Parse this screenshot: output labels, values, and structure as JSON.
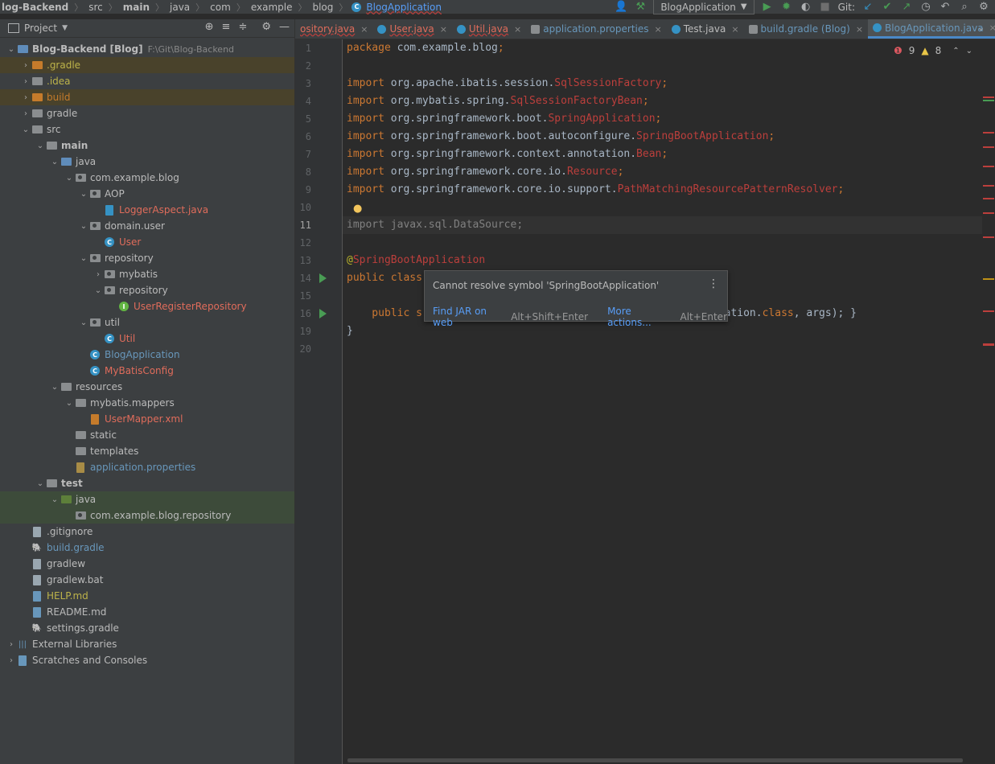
{
  "navbar": {
    "breadcrumbs": [
      "log-Backend",
      "src",
      "main",
      "java",
      "com",
      "example",
      "blog",
      "BlogApplication"
    ],
    "run_config": "BlogApplication",
    "git_label": "Git:"
  },
  "project_panel": {
    "title": "Project",
    "tree": [
      {
        "label": "Blog-Backend [Blog]",
        "path": "F:\\Git\\Blog-Backend",
        "depth": 0,
        "arrow": "down",
        "icon": "module-folder",
        "style": "bold"
      },
      {
        "label": ".gradle",
        "depth": 1,
        "arrow": "right",
        "icon": "folder-orange",
        "style": "yellow",
        "hl": "hl"
      },
      {
        "label": ".idea",
        "depth": 1,
        "arrow": "right",
        "icon": "folder",
        "style": "yellow"
      },
      {
        "label": "build",
        "depth": 1,
        "arrow": "right",
        "icon": "folder-orange",
        "style": "orange",
        "hl": "hl"
      },
      {
        "label": "gradle",
        "depth": 1,
        "arrow": "right",
        "icon": "folder",
        "style": ""
      },
      {
        "label": "src",
        "depth": 1,
        "arrow": "down",
        "icon": "folder",
        "style": ""
      },
      {
        "label": "main",
        "depth": 2,
        "arrow": "down",
        "icon": "folder",
        "style": "bold"
      },
      {
        "label": "java",
        "depth": 3,
        "arrow": "down",
        "icon": "folder-blue",
        "style": ""
      },
      {
        "label": "com.example.blog",
        "depth": 4,
        "arrow": "down",
        "icon": "package",
        "style": ""
      },
      {
        "label": "AOP",
        "depth": 5,
        "arrow": "down",
        "icon": "package",
        "style": ""
      },
      {
        "label": "LoggerAspect.java",
        "depth": 6,
        "arrow": "",
        "icon": "java-file",
        "style": "red"
      },
      {
        "label": "domain.user",
        "depth": 5,
        "arrow": "down",
        "icon": "package",
        "style": ""
      },
      {
        "label": "User",
        "depth": 6,
        "arrow": "",
        "icon": "class",
        "style": "red"
      },
      {
        "label": "repository",
        "depth": 5,
        "arrow": "down",
        "icon": "package",
        "style": ""
      },
      {
        "label": "mybatis",
        "depth": 6,
        "arrow": "right",
        "icon": "package",
        "style": ""
      },
      {
        "label": "repository",
        "depth": 6,
        "arrow": "down",
        "icon": "package",
        "style": ""
      },
      {
        "label": "UserRegisterRepository",
        "depth": 7,
        "arrow": "",
        "icon": "interface",
        "style": "red"
      },
      {
        "label": "util",
        "depth": 5,
        "arrow": "down",
        "icon": "package",
        "style": ""
      },
      {
        "label": "Util",
        "depth": 6,
        "arrow": "",
        "icon": "class",
        "style": "red"
      },
      {
        "label": "BlogApplication",
        "depth": 5,
        "arrow": "",
        "icon": "class-run",
        "style": "blue"
      },
      {
        "label": "MyBatisConfig",
        "depth": 5,
        "arrow": "",
        "icon": "class",
        "style": "red"
      },
      {
        "label": "resources",
        "depth": 3,
        "arrow": "down",
        "icon": "folder",
        "style": ""
      },
      {
        "label": "mybatis.mappers",
        "depth": 4,
        "arrow": "down",
        "icon": "folder",
        "style": ""
      },
      {
        "label": "UserMapper.xml",
        "depth": 5,
        "arrow": "",
        "icon": "xml-file",
        "style": "red"
      },
      {
        "label": "static",
        "depth": 4,
        "arrow": "",
        "icon": "folder",
        "style": ""
      },
      {
        "label": "templates",
        "depth": 4,
        "arrow": "",
        "icon": "folder",
        "style": ""
      },
      {
        "label": "application.properties",
        "depth": 4,
        "arrow": "",
        "icon": "properties-file",
        "style": "blue"
      },
      {
        "label": "test",
        "depth": 2,
        "arrow": "down",
        "icon": "folder",
        "style": "bold"
      },
      {
        "label": "java",
        "depth": 3,
        "arrow": "down",
        "icon": "folder-green",
        "style": "",
        "hl": "hl2"
      },
      {
        "label": "com.example.blog.repository",
        "depth": 4,
        "arrow": "",
        "icon": "package",
        "style": "",
        "hl": "hl2"
      },
      {
        "label": ".gitignore",
        "depth": 1,
        "arrow": "",
        "icon": "file",
        "style": ""
      },
      {
        "label": "build.gradle",
        "depth": 1,
        "arrow": "",
        "icon": "gradle-file",
        "style": "blue"
      },
      {
        "label": "gradlew",
        "depth": 1,
        "arrow": "",
        "icon": "file",
        "style": ""
      },
      {
        "label": "gradlew.bat",
        "depth": 1,
        "arrow": "",
        "icon": "file",
        "style": ""
      },
      {
        "label": "HELP.md",
        "depth": 1,
        "arrow": "",
        "icon": "md-file",
        "style": "yellow"
      },
      {
        "label": "README.md",
        "depth": 1,
        "arrow": "",
        "icon": "md-file",
        "style": ""
      },
      {
        "label": "settings.gradle",
        "depth": 1,
        "arrow": "",
        "icon": "gradle-file",
        "style": ""
      },
      {
        "label": "External Libraries",
        "depth": 0,
        "arrow": "right",
        "icon": "libraries",
        "style": ""
      },
      {
        "label": "Scratches and Consoles",
        "depth": 0,
        "arrow": "right",
        "icon": "scratches",
        "style": ""
      }
    ]
  },
  "tabs": [
    {
      "label": "ository.java",
      "style": "red",
      "active": false
    },
    {
      "label": "User.java",
      "style": "red",
      "active": false
    },
    {
      "label": "Util.java",
      "style": "red",
      "active": false
    },
    {
      "label": "application.properties",
      "style": "blue",
      "active": false
    },
    {
      "label": "Test.java",
      "style": "",
      "active": false
    },
    {
      "label": "build.gradle (Blog)",
      "style": "blue",
      "active": false
    },
    {
      "label": "BlogApplication.java",
      "style": "blue",
      "active": true
    }
  ],
  "editor": {
    "line_numbers": [
      "1",
      "2",
      "3",
      "4",
      "5",
      "6",
      "7",
      "8",
      "9",
      "10",
      "11",
      "12",
      "13",
      "14",
      "15",
      "16",
      "19",
      "20"
    ],
    "errors": "9",
    "warnings": "8",
    "lines": [
      [
        {
          "t": "package ",
          "c": "kw"
        },
        {
          "t": "com.example.blog",
          "c": ""
        },
        {
          "t": ";",
          "c": "kw"
        }
      ],
      [],
      [
        {
          "t": "import ",
          "c": "kw"
        },
        {
          "t": "org.apache.ibatis.session.",
          "c": ""
        },
        {
          "t": "SqlSessionFactory",
          "c": "err"
        },
        {
          "t": ";",
          "c": "kw"
        }
      ],
      [
        {
          "t": "import ",
          "c": "kw"
        },
        {
          "t": "org.mybatis.spring.",
          "c": ""
        },
        {
          "t": "SqlSessionFactoryBean",
          "c": "err"
        },
        {
          "t": ";",
          "c": "kw"
        }
      ],
      [
        {
          "t": "import ",
          "c": "kw"
        },
        {
          "t": "org.springframework.boot.",
          "c": ""
        },
        {
          "t": "SpringApplication",
          "c": "err"
        },
        {
          "t": ";",
          "c": "kw"
        }
      ],
      [
        {
          "t": "import ",
          "c": "kw"
        },
        {
          "t": "org.springframework.boot.autoconfigure.",
          "c": ""
        },
        {
          "t": "SpringBootApplication",
          "c": "err"
        },
        {
          "t": ";",
          "c": "kw"
        }
      ],
      [
        {
          "t": "import ",
          "c": "kw"
        },
        {
          "t": "org.springframework.context.annotation.",
          "c": ""
        },
        {
          "t": "Bean",
          "c": "err"
        },
        {
          "t": ";",
          "c": "kw"
        }
      ],
      [
        {
          "t": "import ",
          "c": "kw"
        },
        {
          "t": "org.springframework.core.io.",
          "c": ""
        },
        {
          "t": "Resource",
          "c": "err"
        },
        {
          "t": ";",
          "c": "kw"
        }
      ],
      [
        {
          "t": "import ",
          "c": "kw"
        },
        {
          "t": "org.springframework.core.io.support.",
          "c": ""
        },
        {
          "t": "PathMatchingResourcePatternResolver",
          "c": "err"
        },
        {
          "t": ";",
          "c": "kw"
        }
      ],
      [],
      [
        {
          "t": "import javax.sql.DataSource;",
          "c": "greyed"
        }
      ],
      [],
      [
        {
          "t": "@",
          "c": "ann"
        },
        {
          "t": "SpringBootApplication",
          "c": "err"
        }
      ],
      [
        {
          "t": "public class",
          "c": "kw"
        }
      ],
      [],
      [
        {
          "t": "    public s",
          "c": "kw"
        },
        {
          "t": "                              ",
          "c": ""
        },
        {
          "t": "ion",
          "c": "err"
        },
        {
          "t": ".run(BlogApplication.",
          "c": ""
        },
        {
          "t": "class",
          "c": "kw"
        },
        {
          "t": ", args); }",
          "c": ""
        }
      ],
      [
        {
          "t": "}",
          "c": ""
        }
      ],
      []
    ]
  },
  "tooltip": {
    "message": "Cannot resolve symbol 'SpringBootApplication'",
    "action1": "Find JAR on web",
    "key1": "Alt+Shift+Enter",
    "action2": "More actions...",
    "key2": "Alt+Enter"
  }
}
